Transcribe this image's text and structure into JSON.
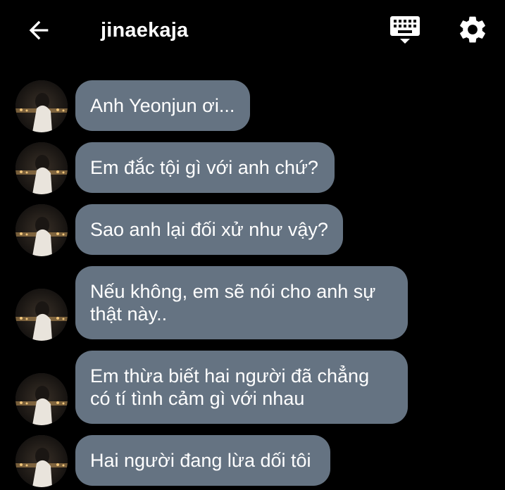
{
  "header": {
    "title": "jinaekaja",
    "back_icon": "arrow-back-icon",
    "keyboard_icon": "keyboard-icon",
    "settings_icon": "gear-icon"
  },
  "colors": {
    "background": "#000000",
    "bubble": "#657382",
    "text": "#ffffff"
  },
  "messages": [
    {
      "text": "Anh Yeonjun ơi..."
    },
    {
      "text": "Em đắc tội gì với anh chứ?"
    },
    {
      "text": "Sao anh lại đối xử như vậy?"
    },
    {
      "line1": "Nếu không, em sẽ nói cho anh sự",
      "line2": "thật này.."
    },
    {
      "line1": "Em thừa biết hai người đã chẳng",
      "line2": "có tí tình cảm gì với nhau"
    },
    {
      "text": "Hai người đang lừa dối tôi"
    }
  ]
}
